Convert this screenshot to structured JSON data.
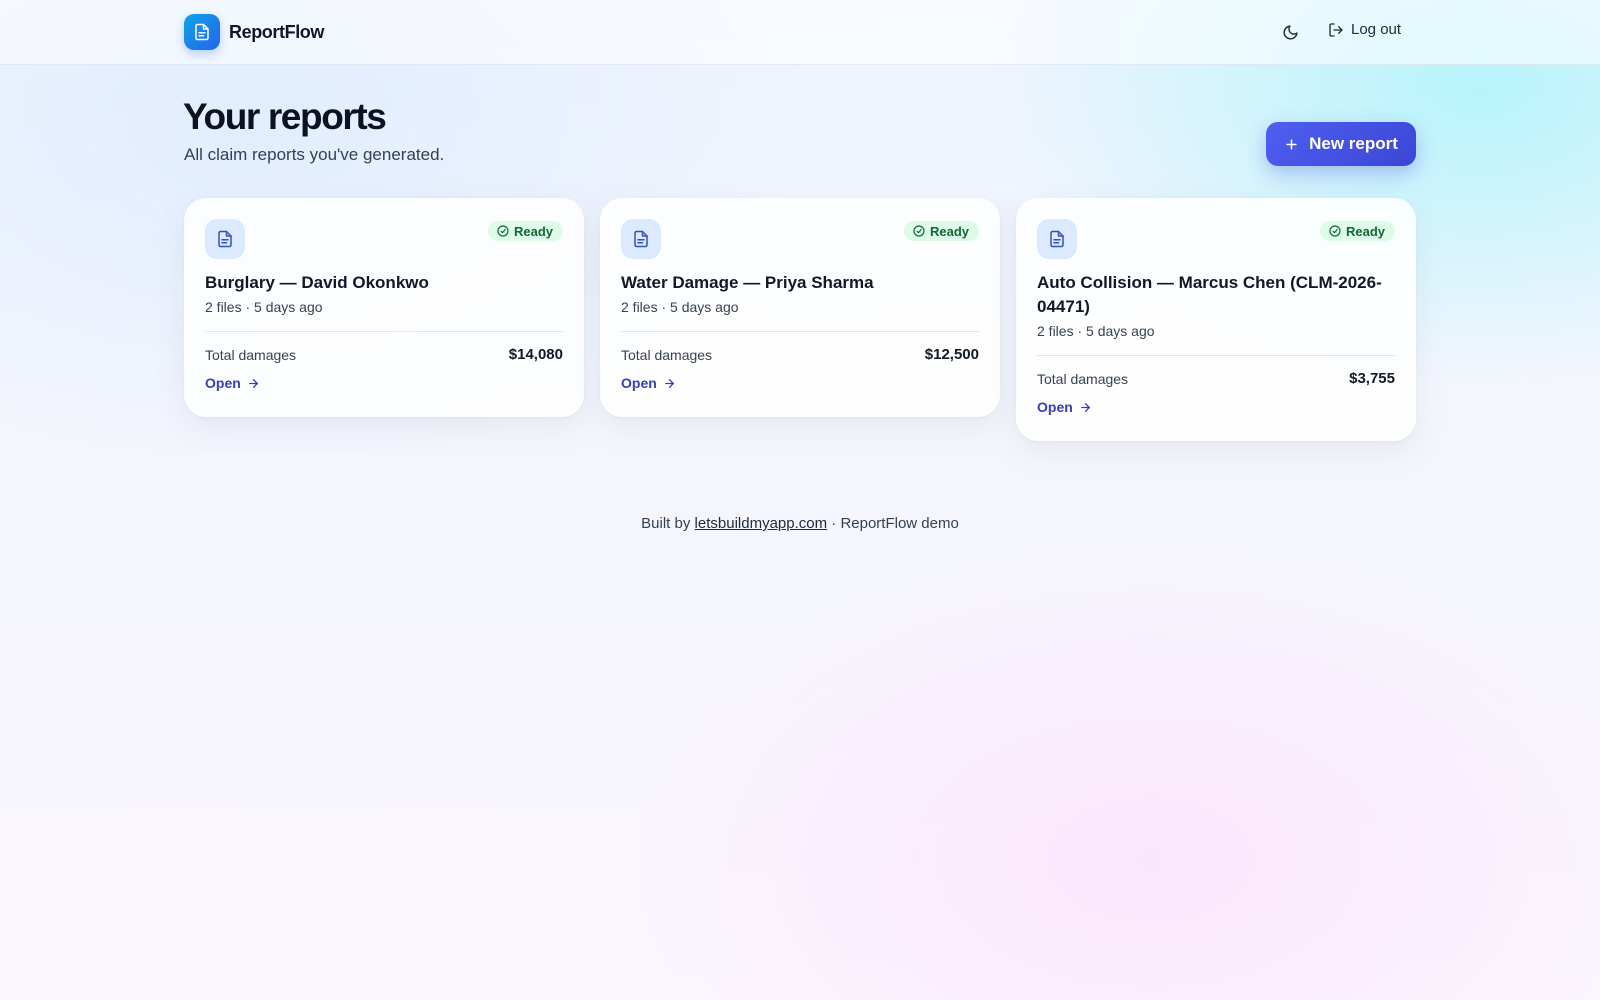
{
  "header": {
    "brand_name": "ReportFlow",
    "logout_label": "Log out"
  },
  "main": {
    "title": "Your reports",
    "subtitle": "All claim reports you've generated.",
    "new_report_label": "New report"
  },
  "reports": [
    {
      "status": "Ready",
      "title": "Burglary — David Okonkwo",
      "meta": "2 files · 5 days ago",
      "totals_label": "Total damages",
      "totals_value": "$14,080",
      "open_label": "Open"
    },
    {
      "status": "Ready",
      "title": "Water Damage — Priya Sharma",
      "meta": "2 files · 5 days ago",
      "totals_label": "Total damages",
      "totals_value": "$12,500",
      "open_label": "Open"
    },
    {
      "status": "Ready",
      "title": "Auto Collision — Marcus Chen (CLM-2026-04471)",
      "meta": "2 files · 5 days ago",
      "totals_label": "Total damages",
      "totals_value": "$3,755",
      "open_label": "Open"
    }
  ],
  "footer": {
    "prefix": "Built by",
    "link_text": "letsbuildmyapp.com",
    "suffix": "· ReportFlow demo"
  },
  "icons": {
    "brand": "document-icon",
    "theme": "moon-icon",
    "logout": "logout-icon",
    "new_report": "plus-icon",
    "report_tile": "document-icon",
    "status": "check-circle-icon",
    "open": "arrow-right-icon"
  },
  "colors": {
    "accent": "#4350de",
    "link": "#3340b8",
    "status_bg": "#dcfce7",
    "status_text": "#166534",
    "doc_tile_bg": "#dbeafe"
  }
}
